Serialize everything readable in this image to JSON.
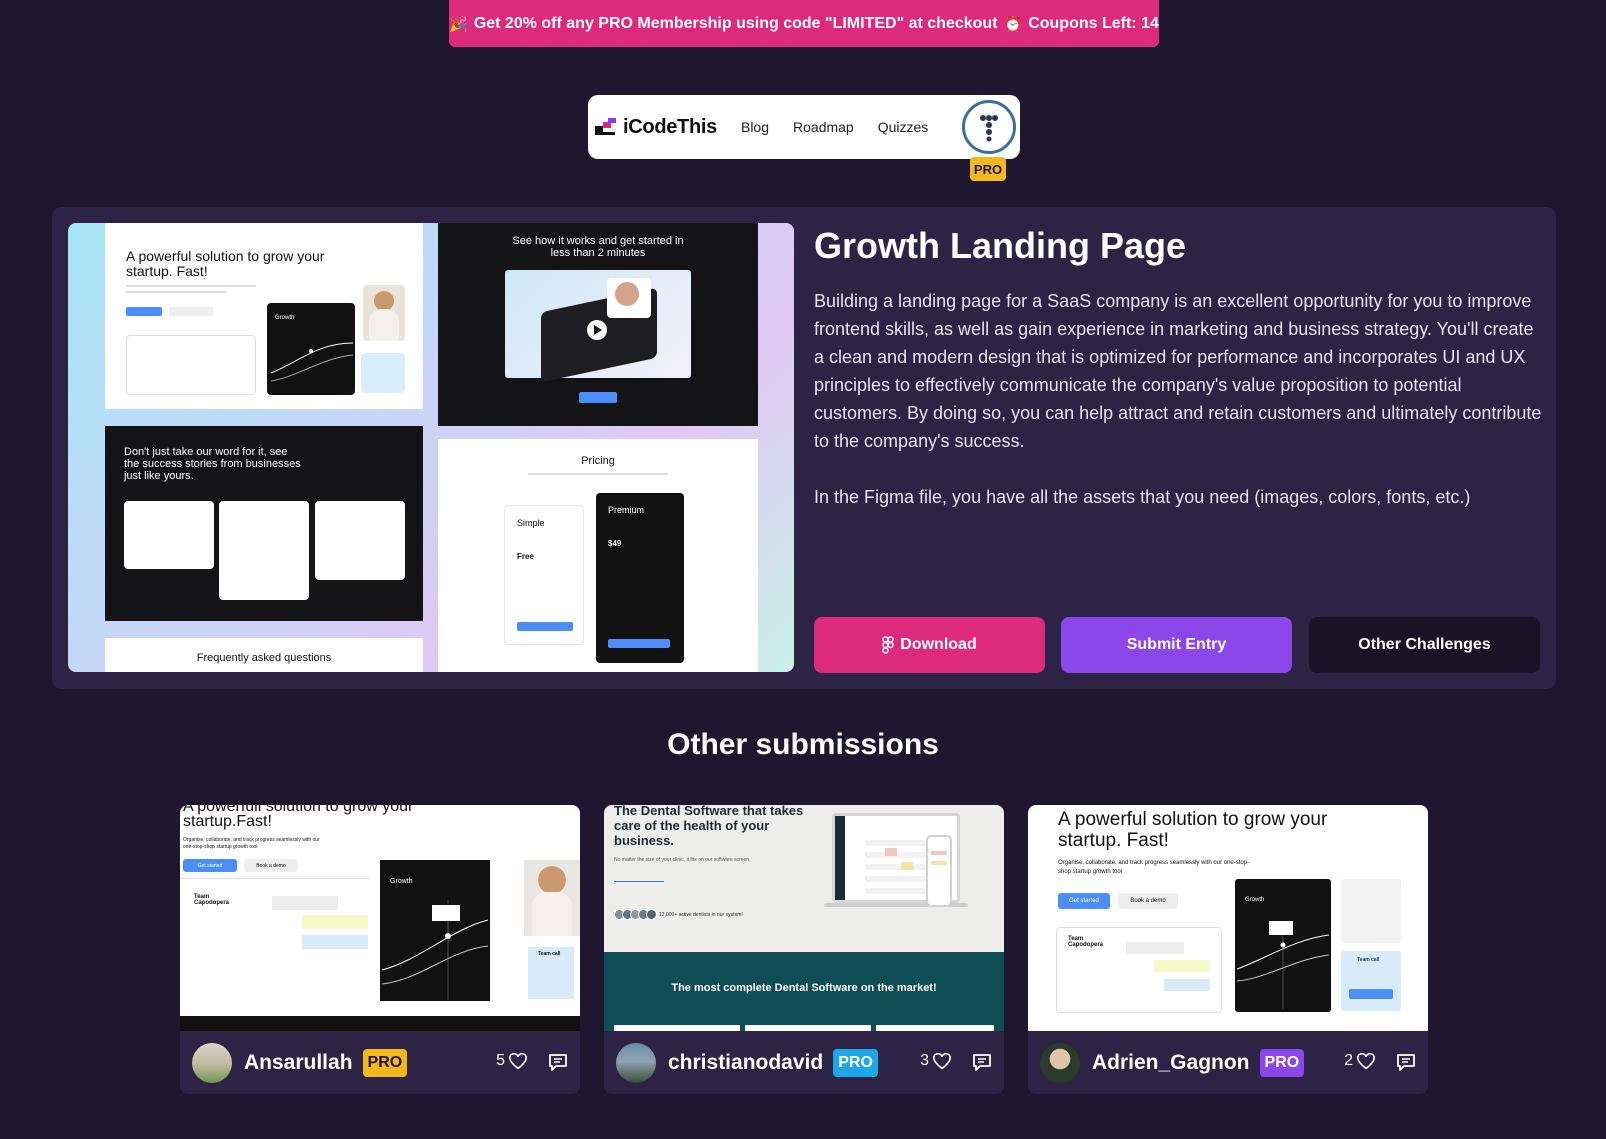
{
  "promo": {
    "lead_emoji": "🎉",
    "text": "Get 20% off any PRO Membership using code \"LIMITED\" at checkout",
    "clock_emoji": "⏰",
    "coupons": "Coupons Left: 14"
  },
  "nav": {
    "logo": "iCodeThis",
    "links": [
      "Blog",
      "Roadmap",
      "Quizzes"
    ],
    "pro_badge": "PRO"
  },
  "challenge": {
    "title": "Growth Landing Page",
    "description": "Building a landing page for a SaaS company is an excellent opportunity for you to improve frontend skills, as well as gain experience in marketing and business strategy. You'll create a clean and modern design that is optimized for performance and incorporates UI and UX principles to effectively communicate the company's value proposition to potential customers. By doing so, you can help attract and retain customers and ultimately contribute to the company's success.",
    "assets_note": "In the Figma file, you have all the assets that you need (images, colors, fonts, etc.)",
    "buttons": {
      "download": "Download",
      "submit": "Submit Entry",
      "other": "Other Challenges"
    },
    "preview": {
      "hero_title": "A powerful solution to grow your startup. Fast!",
      "how_title": "See how it works and get started in less than 2 minutes",
      "testimonial_title": "Don't just take our word for it, see the success  stories from businesses just like yours.",
      "pricing_title": "Pricing",
      "plan_simple": "Simple",
      "plan_free": "Free",
      "plan_premium": "Premium",
      "premium_price": "$49",
      "faq_title": "Frequently asked questions",
      "growth_label": "Growth"
    }
  },
  "submissions_title": "Other submissions",
  "submissions": [
    {
      "username": "Ansarullah",
      "pro": "PRO",
      "pro_color": "#f3b81c",
      "pro_text_color": "#1f1730",
      "likes": "5",
      "thumb_title": "A powerfull solution to grow your startup.Fast!",
      "thumb_sub": "Organise, collaborate, and track progress seamlessly with our one-stop-shop startup growth tool",
      "thumb_btn": "Get started",
      "thumb_btn2": "Book a demo",
      "team_label": "Team Capodopera",
      "growth_label": "Growth",
      "call_label": "Team call"
    },
    {
      "username": "christianodavid",
      "pro": "PRO",
      "pro_color": "#1ea7e6",
      "pro_text_color": "#ffffff",
      "likes": "3",
      "thumb_title": "The Dental Software that takes care of the health of your business.",
      "thumb_sub": "No matter the size of your clinic, it fits on our software screen.",
      "thumb_stat": "12,000+ active dentists in our system!",
      "thumb_banner": "The most complete Dental Software on the market!"
    },
    {
      "username": "Adrien_Gagnon",
      "pro": "PRO",
      "pro_color": "#8b47ea",
      "pro_text_color": "#ffffff",
      "likes": "2",
      "thumb_title": "A powerful solution to grow your startup. Fast!",
      "thumb_sub": "Organise, collaborate, and track progress seamlessly with our one-stop-shop startup growth tool",
      "thumb_btn": "Get started",
      "thumb_btn2": "Book a demo",
      "team_label": "Team Capodopera",
      "growth_label": "Growth",
      "call_label": "Team call"
    }
  ]
}
